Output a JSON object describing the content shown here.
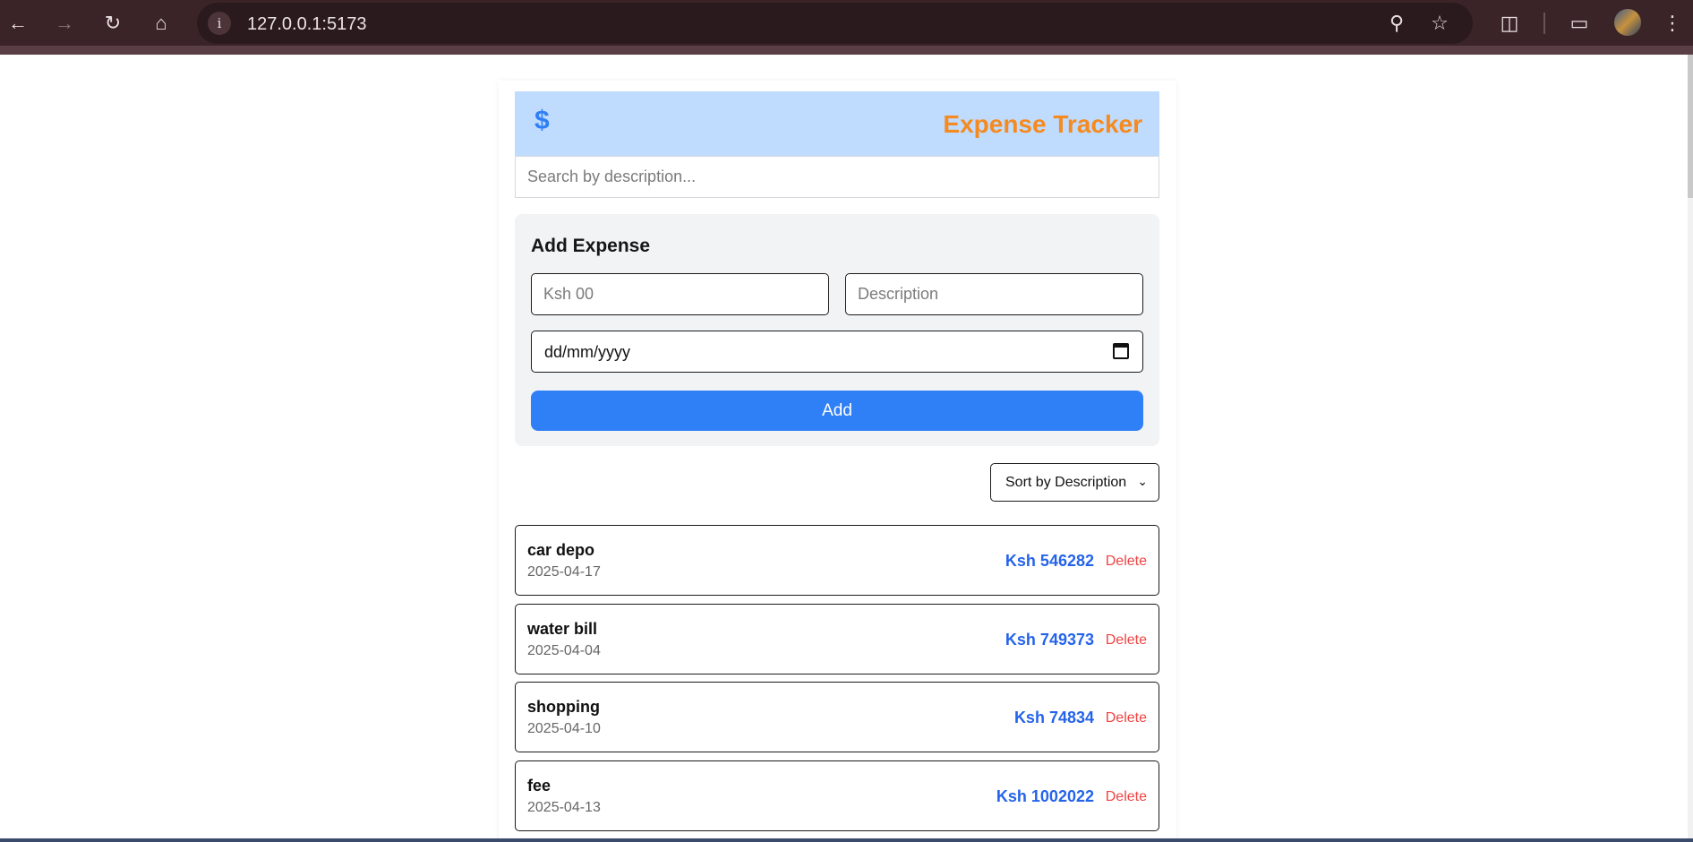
{
  "browser": {
    "url": "127.0.0.1:5173",
    "icons": [
      "back-icon",
      "forward-icon",
      "reload-icon",
      "home-icon",
      "info-icon",
      "zoom-icon",
      "star-icon",
      "extensions-icon",
      "cast-icon",
      "profile-avatar",
      "menu-icon"
    ]
  },
  "header": {
    "logo": "$",
    "title": "Expense Tracker"
  },
  "search": {
    "placeholder": "Search by description..."
  },
  "form": {
    "title": "Add Expense",
    "amount_placeholder": "Ksh 00",
    "description_placeholder": "Description",
    "date_value": "dd/mm/yyyy",
    "add_label": "Add"
  },
  "sort": {
    "selected": "Sort by Description"
  },
  "expenses": [
    {
      "description": "car depo",
      "date": "2025-04-17",
      "amount": "Ksh 546282",
      "delete_label": "Delete"
    },
    {
      "description": "water bill",
      "date": "2025-04-04",
      "amount": "Ksh 749373",
      "delete_label": "Delete"
    },
    {
      "description": "shopping",
      "date": "2025-04-10",
      "amount": "Ksh 74834",
      "delete_label": "Delete"
    },
    {
      "description": "fee",
      "date": "2025-04-13",
      "amount": "Ksh 1002022",
      "delete_label": "Delete"
    }
  ],
  "colors": {
    "header_bg": "#bfdbfe",
    "title": "#f58a1f",
    "accent": "#2f7ff6",
    "amount": "#2563eb",
    "delete": "#ef4444"
  }
}
